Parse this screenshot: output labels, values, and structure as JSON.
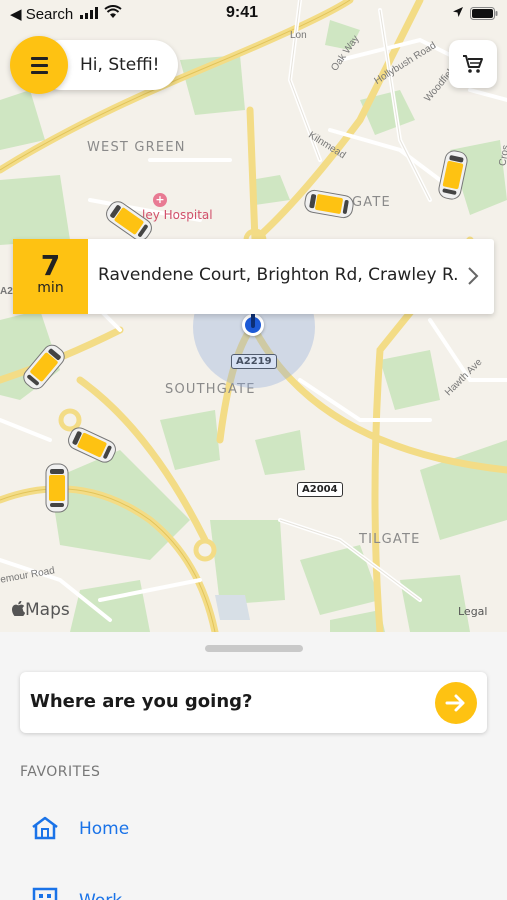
{
  "status_bar": {
    "back_label": "◀ Search",
    "time": "9:41"
  },
  "greeting": "Hi, Steffi!",
  "eta": {
    "minutes": "7",
    "unit": "min",
    "address": "Ravendene Court, Brighton Rd, Crawley R..."
  },
  "map": {
    "areas": {
      "west_green": "WEST GREEN",
      "southgate": "SOUTHGATE",
      "tilgate": "TILGATE",
      "gate_partial": "GATE"
    },
    "hospital": "ley Hospital",
    "roads": {
      "oak_way": "Oak Way",
      "hollybush": "Hollybush Road",
      "woodfield": "Woodfield Road",
      "kilnmead": "Kilnmead",
      "hawth": "Hawth Ave",
      "mour": "emour Road",
      "a22": "A2",
      "cros": "Cros",
      "lon": "Lon"
    },
    "shields": {
      "a2219": "A2219",
      "a2004": "A2004"
    },
    "logo": "Maps",
    "legal": "Legal"
  },
  "search": {
    "placeholder": "Where are you going?"
  },
  "favorites": {
    "title": "FAVORITES",
    "items": [
      {
        "label": "Home",
        "icon": "home-icon"
      },
      {
        "label": "Work",
        "icon": "work-icon"
      }
    ]
  },
  "colors": {
    "accent": "#fec212",
    "link": "#1a73e8",
    "pin": "#1d5ad6"
  }
}
